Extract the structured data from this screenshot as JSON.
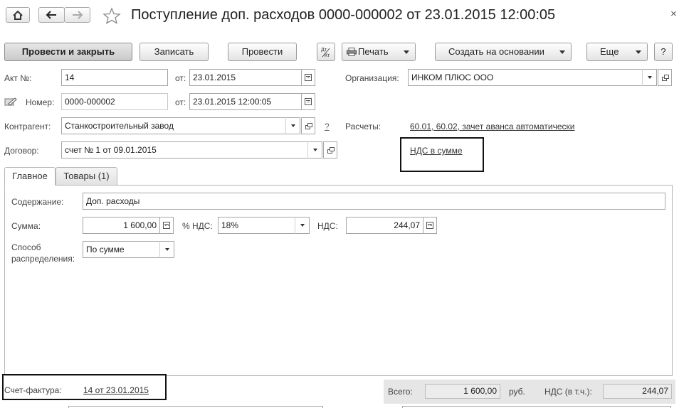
{
  "window": {
    "title": "Поступление доп. расходов 0000-000002 от 23.01.2015 12:00:05",
    "close_glyph": "×"
  },
  "toolbar": {
    "post_close": "Провести и закрыть",
    "save": "Записать",
    "post": "Провести",
    "dtkt_icon": "dt-kt-icon",
    "print": "Печать",
    "create_based": "Создать на основании",
    "more": "Еще",
    "help": "?"
  },
  "header": {
    "act_no_label": "Акт №:",
    "act_no_value": "14",
    "act_date_label": "от:",
    "act_date_value": "23.01.2015",
    "org_label": "Организация:",
    "org_value": "ИНКОМ ПЛЮС ООО",
    "number_label": "Номер:",
    "number_value": "0000-000002",
    "number_date_label": "от:",
    "number_date_value": "23.01.2015 12:00:05",
    "counterparty_label": "Контрагент:",
    "counterparty_value": "Станкостроительный завод",
    "counterparty_help": "?",
    "settlements_label": "Расчеты:",
    "settlements_link": "60.01, 60.02, зачет аванса автоматически",
    "contract_label": "Договор:",
    "contract_value": "счет № 1 от 09.01.2015",
    "vat_link": "НДС в сумме"
  },
  "tabs": [
    {
      "label": "Главное",
      "active": true
    },
    {
      "label": "Товары (1)",
      "active": false
    }
  ],
  "main": {
    "content_label": "Содержание:",
    "content_value": "Доп. расходы",
    "sum_label": "Сумма:",
    "sum_value": "1 600,00",
    "vat_rate_label": "% НДС:",
    "vat_rate_value": "18%",
    "vat_label": "НДС:",
    "vat_value": "244,07",
    "distribution_label_1": "Способ",
    "distribution_label_2": "распределения:",
    "distribution_value": "По сумме"
  },
  "footer": {
    "invoice_label": "Счет-фактура:",
    "invoice_link": "14 от 23.01.2015",
    "total_label": "Всего:",
    "total_value": "1 600,00",
    "currency": "руб.",
    "vat_incl_label": "НДС (в т.ч.):",
    "vat_incl_value": "244,07"
  }
}
